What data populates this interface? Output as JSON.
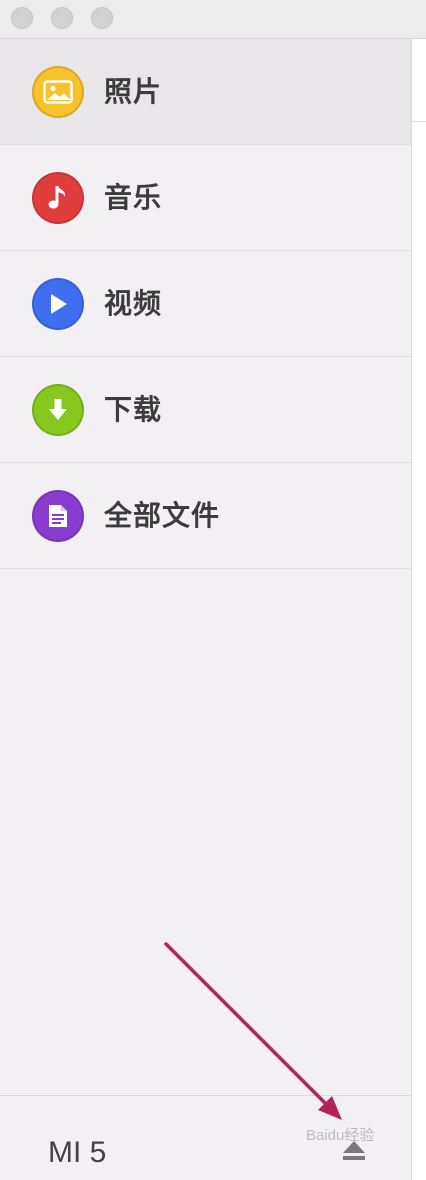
{
  "sidebar": {
    "items": [
      {
        "label": "照片",
        "icon": "photo-icon",
        "color": "#f7c22a"
      },
      {
        "label": "音乐",
        "icon": "music-note-icon",
        "color": "#e23d3d"
      },
      {
        "label": "视频",
        "icon": "play-icon",
        "color": "#3f6ef0"
      },
      {
        "label": "下载",
        "icon": "download-icon",
        "color": "#86c81e"
      },
      {
        "label": "全部文件",
        "icon": "document-icon",
        "color": "#8a3bd0"
      }
    ],
    "selected_index": 0
  },
  "device": {
    "name": "MI 5",
    "eject_icon": "eject-icon"
  },
  "annotation": {
    "arrow_color": "#b0245a"
  },
  "watermark": {
    "text": "Baidu经验"
  }
}
